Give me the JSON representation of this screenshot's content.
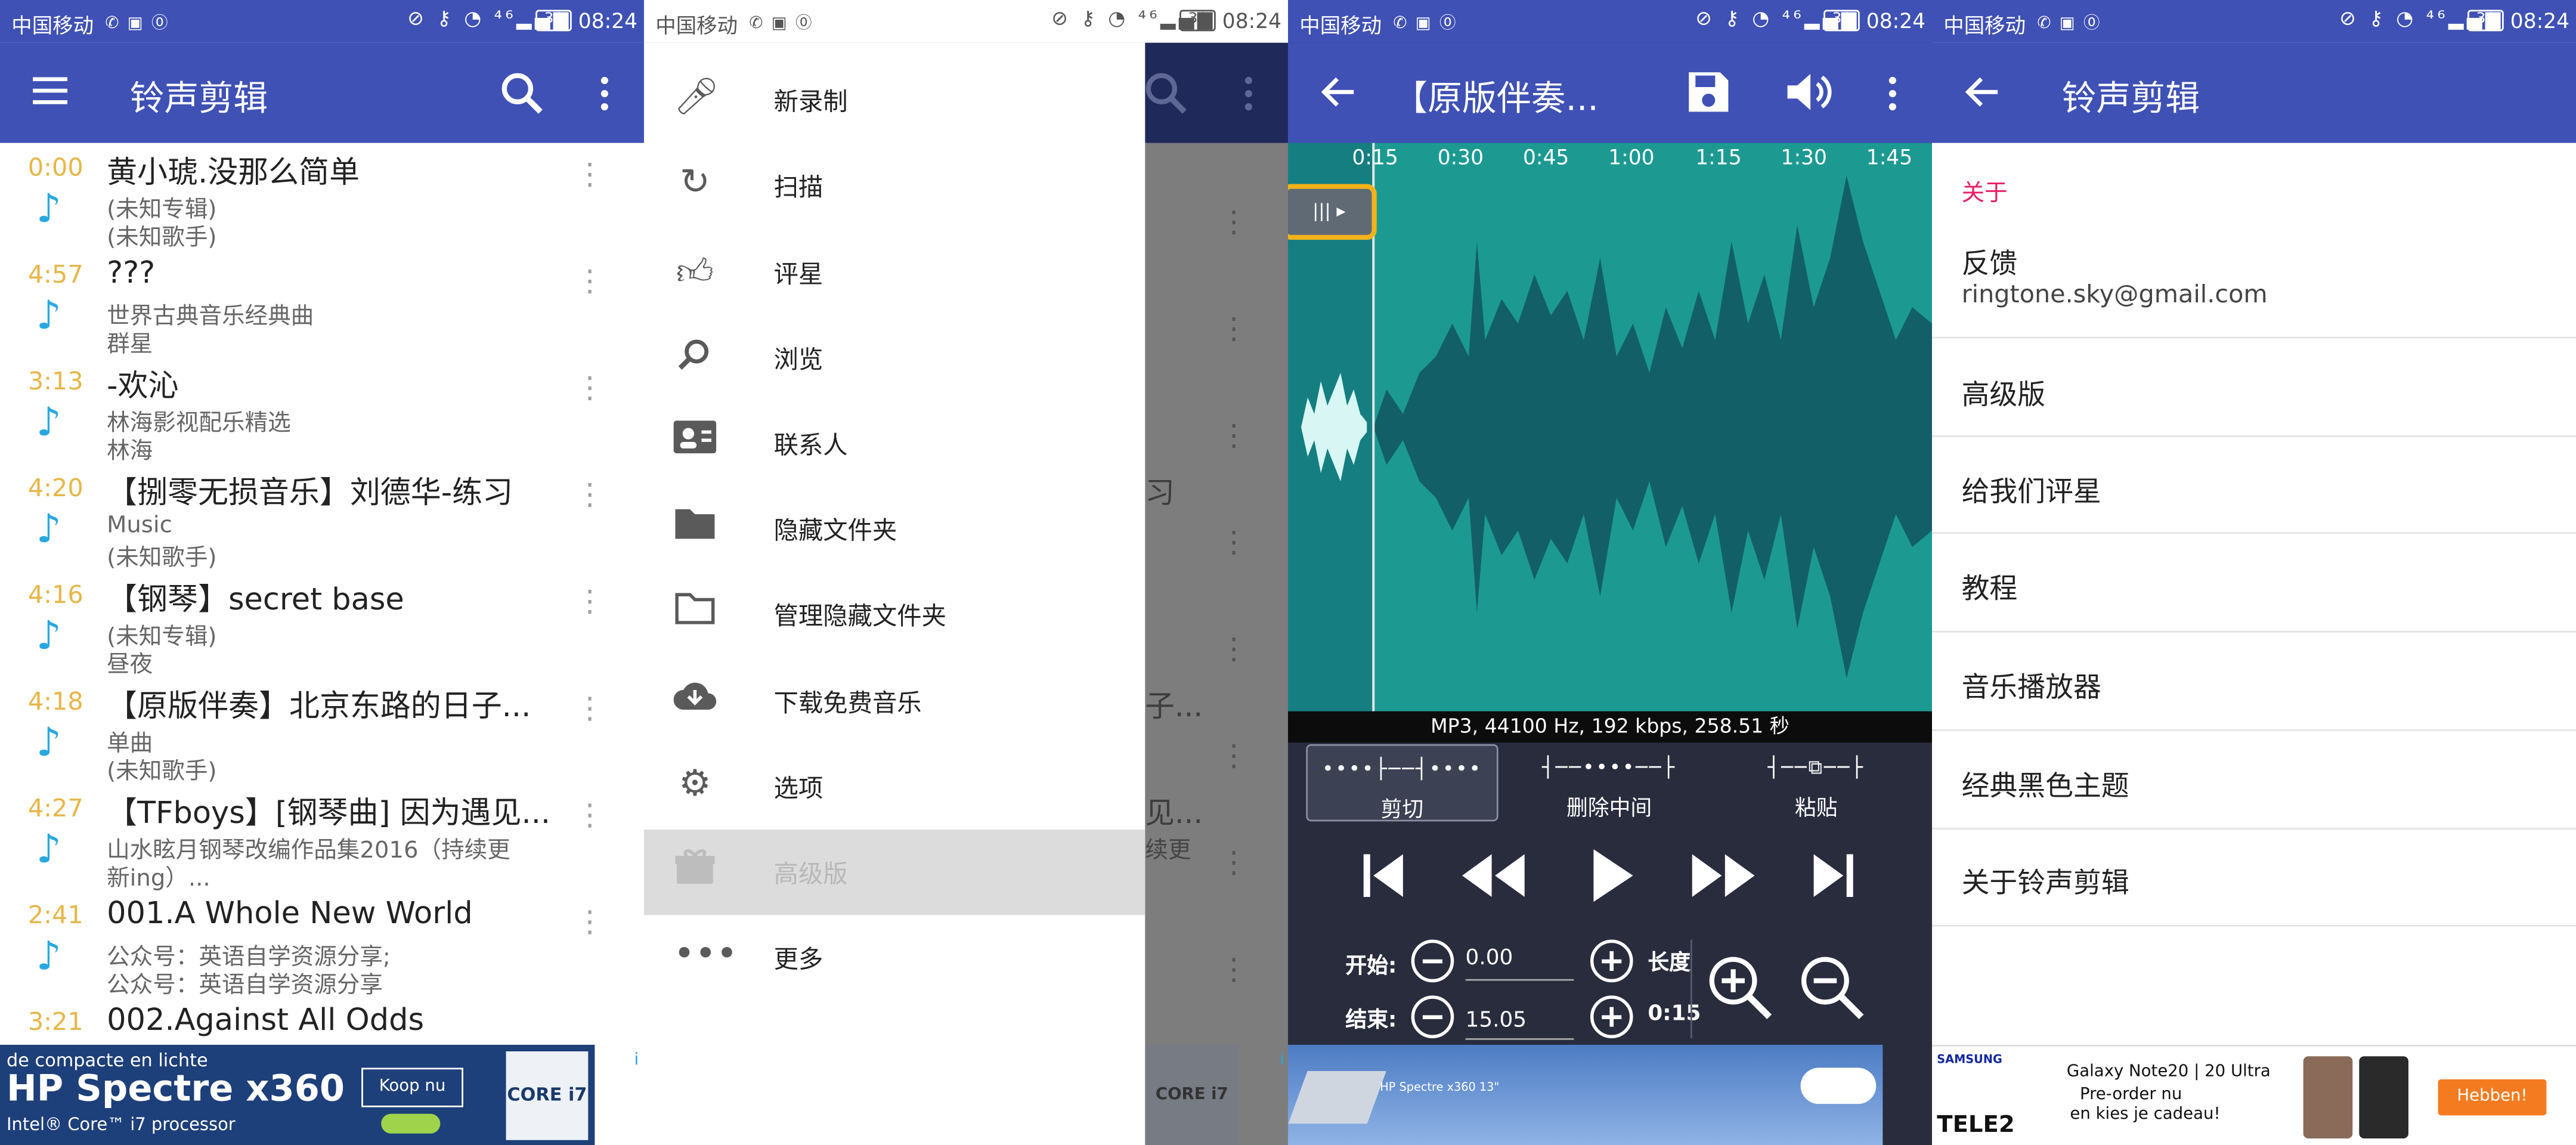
{
  "status_bar": {
    "carrier": "中国移动",
    "battery": "36",
    "time": "08:24"
  },
  "screen1": {
    "title": "铃声剪辑",
    "songs": [
      {
        "duration": "0:00",
        "title": "黄小琥.没那么简单",
        "line2": "(未知专辑)",
        "line3": "(未知歌手)"
      },
      {
        "duration": "4:57",
        "title": "???",
        "line2": "世界古典音乐经典曲",
        "line3": "群星"
      },
      {
        "duration": "3:13",
        "title": "-欢沁",
        "line2": "林海影视配乐精选",
        "line3": "林海"
      },
      {
        "duration": "4:20",
        "title": "【捌零无损音乐】刘德华-练习",
        "line2": "Music",
        "line3": "(未知歌手)"
      },
      {
        "duration": "4:16",
        "title": "【钢琴】secret base",
        "line2": "(未知专辑)",
        "line3": "昼夜"
      },
      {
        "duration": "4:18",
        "title": "【原版伴奏】北京东路的日子...",
        "line2": "单曲",
        "line3": "(未知歌手)"
      },
      {
        "duration": "4:27",
        "title": "【TFboys】[钢琴曲] 因为遇见...",
        "line2": "山水眩月钢琴改编作品集2016（持续更",
        "line3": "新ing）..."
      },
      {
        "duration": "2:41",
        "title": "001.A Whole New World",
        "line2": "公众号：英语自学资源分享;",
        "line3": "公众号：英语自学资源分享"
      },
      {
        "duration": "3:21",
        "title": "002.Against All Odds",
        "line2": "",
        "line3": ""
      }
    ],
    "ad": {
      "line1": "de compacte en lichte",
      "line2": "HP Spectre x360",
      "line3": "Intel® Core™ i7 processor",
      "button": "Koop nu",
      "chip": "CORE i7"
    }
  },
  "screen2": {
    "drawer_items": [
      {
        "label": "新录制",
        "icon": "mic-icon"
      },
      {
        "label": "扫描",
        "icon": "refresh-icon"
      },
      {
        "label": "评星",
        "icon": "thumb-up-icon"
      },
      {
        "label": "浏览",
        "icon": "browse-icon"
      },
      {
        "label": "联系人",
        "icon": "contacts-icon"
      },
      {
        "label": "隐藏文件夹",
        "icon": "folder-icon"
      },
      {
        "label": "管理隐藏文件夹",
        "icon": "folder-outline-icon"
      },
      {
        "label": "下载免费音乐",
        "icon": "cloud-download-icon"
      },
      {
        "label": "选项",
        "icon": "gear-icon"
      },
      {
        "label": "高级版",
        "icon": "gift-icon",
        "selected": true
      },
      {
        "label": "更多",
        "icon": "more-horiz-icon"
      }
    ],
    "bg_fragments": [
      "习",
      "子...",
      "见...",
      "续更"
    ],
    "ad_chip": "CORE i7"
  },
  "screen3": {
    "title": "【原版伴奏...",
    "timeline": [
      "0:15",
      "0:30",
      "0:45",
      "1:00",
      "1:15",
      "1:30",
      "1:45"
    ],
    "info": "MP3, 44100 Hz, 192 kbps, 258.51 秒",
    "modes": [
      {
        "label": "剪切",
        "selected": true
      },
      {
        "label": "删除中间"
      },
      {
        "label": "粘贴"
      }
    ],
    "start_label": "开始:",
    "start_value": "0.00",
    "end_label": "结束:",
    "end_value": "15.05",
    "length_label": "长度",
    "length_value": "0:15",
    "ad": "HP Spectre x360 13\""
  },
  "screen4": {
    "title": "铃声剪辑",
    "section": "关于",
    "feedback_label": "反馈",
    "feedback_email": "ringtone.sky@gmail.com",
    "rows": [
      "高级版",
      "给我们评星",
      "教程",
      "音乐播放器",
      "经典黑色主题",
      "关于铃声剪辑"
    ],
    "ad": {
      "brand": "SAMSUNG",
      "line1": "Galaxy Note20 | 20 Ultra",
      "line2": "Pre-order nu",
      "line3": "en kies je cadeau!",
      "button": "Hebben!",
      "telco": "TELE2"
    }
  },
  "colors": {
    "primary": "#3f51b5",
    "accent": "#e91e63",
    "duration": "#e6b646",
    "note": "#29a8e0",
    "wave_bg": "#1c9a92",
    "wave": "#135f67",
    "editor_panel": "#282c3d"
  }
}
